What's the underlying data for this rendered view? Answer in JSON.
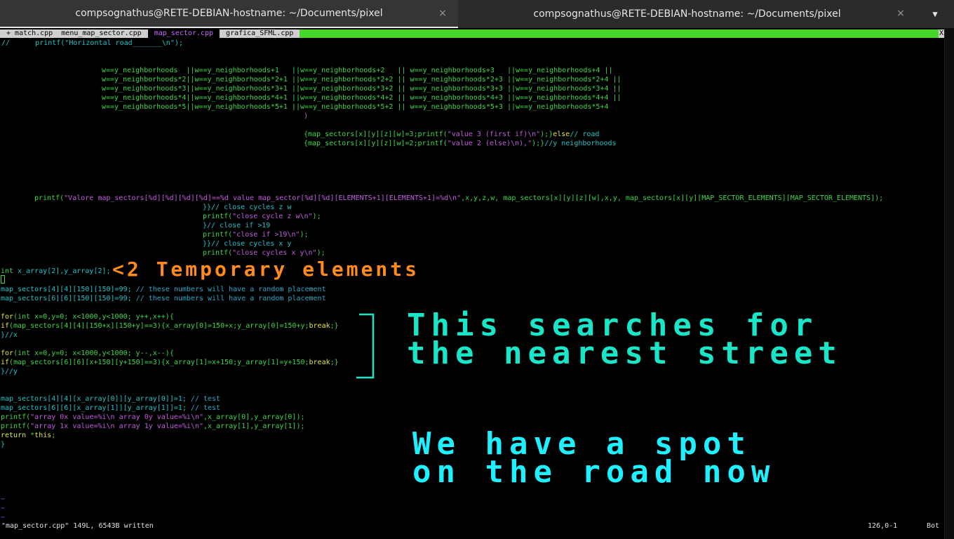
{
  "window": {
    "tabs": [
      {
        "title": "compsognathus@RETE-DEBIAN-hostname: ~/Documents/pixel",
        "active": true
      },
      {
        "title": "compsognathus@RETE-DEBIAN-hostname: ~/Documents/pixel",
        "active": false
      }
    ],
    "close_glyph": "×",
    "menu_glyph": "▼"
  },
  "vim": {
    "tabline": {
      "tabs": [
        {
          "label": " + match.cpp  menu_map_sector.cpp ",
          "selected": false
        },
        {
          "label": " map_sector.cpp ",
          "selected": true
        },
        {
          "label": " grafica_SFML.cpp ",
          "selected": false
        }
      ],
      "close_label": "X"
    },
    "lines": {
      "l1": "//      printf(\"Horizontal road_______\\n\");",
      "c1a": "w==y_neighborhoods  ||w==y_neighborhoods+1   ||",
      "c1b": "w==y_neighborhoods+2   || w==y_neighborhoods+3   ||w==y_neighborhoods+4 ||",
      "c2a": "w==y_neighborhoods*2||w==y_neighborhoods*2+1 ||",
      "c2b": "w==y_neighborhoods*2+2 || w==y_neighborhoods*2+3 ||w==y_neighborhoods*2+4 ||",
      "c3a": "w==y_neighborhoods*3||w==y_neighborhoods*3+1 ||",
      "c3b": "w==y_neighborhoods*3+2 || w==y_neighborhoods*3+3 ||w==y_neighborhoods*3+4 ||",
      "c4a": "w==y_neighborhoods*4||w==y_neighborhoods*4+1 ||",
      "c4b": "w==y_neighborhoods*4+2 || w==y_neighborhoods*4+3 ||w==y_neighborhoods*4+4 ||",
      "c5a": "w==y_neighborhoods*5||w==y_neighborhoods*5+1 ||",
      "c5b": "w==y_neighborhoods*5+2 || w==y_neighborhoods*5+3 ||w==y_neighborhoods*5+4",
      "paren": ")",
      "v3a": "{map_sectors[x][y][z][w]=3;printf(",
      "v3b": "\"value 3 (first if)\\n\"",
      "v3c": ");}",
      "v3d": "else",
      "v3e": "// road",
      "v2a": "{map_sectors[x][y][z][w]=2;printf(",
      "v2b": "\"value 2 (else)\\n),\"",
      "v2c": ");}",
      "v2d": "//y neighborhoods",
      "pv1": "printf(",
      "pv2": "\"Valore map_sectors[%d][%d][%d][%d]==%d value map_sector[%d][%d][ELEMENTS+1][ELEMENTS+1]=%d\\n\"",
      "pv3": ",x,y,z,w, map_sectors[x][y][z][w],x,y, map_sectors[x][y][MAP_SECTOR_ELEMENTS][MAP_SECTOR_ELEMENTS]);",
      "cc1": "}}// close cycles z w",
      "cc2a": "printf(",
      "cc2b": "\"close cycle z w\\n\"",
      "cc2c": ");",
      "cc3": "}// close if >19",
      "cc4a": "printf(",
      "cc4b": "\"close if >19\\n\"",
      "cc4c": ");",
      "cc5": "}}// close cycles x y",
      "cc6a": "printf(",
      "cc6b": "\"close cycles x y\\n\"",
      "cc6c": ");",
      "ia1": "int",
      "ia2": " x_array[2],y_array[2];",
      "ms1a": "map_sectors[4][4][150][150]=99;",
      "ms1b": " // these numbers will have a random placement",
      "ms2a": "map_sectors[6][6][150][150]=99;",
      "ms2b": " // these numbers will have a random placement",
      "f1a": "for",
      "f1b": "(int x=0,y=0; x<1000,y<1000; y++,x++){",
      "if1a": "if",
      "if1b": "(map_sectors[4][4][150+x][150+y]==3){x_array[0]=150+x;y_array[0]=150+y;",
      "if1c": "break",
      "if1d": ";}",
      "cx": "}//x",
      "f2a": "for",
      "f2b": "(int x=0,y=0; x<1000,y<1000; y--,x--){",
      "if2a": "if",
      "if2b": "(map_sectors[6][6][x+150][y+150]==3){x_array[1]=x+150;y_array[1]=y+150;",
      "if2c": "break",
      "if2d": ";}",
      "cyl": "}//y",
      "t1a": "map_sectors[4][4][x_array[0]][y_array[0]]=1;",
      "t1b": " // test",
      "t2a": "map_sectors[6][6][x_array[1]][y_array[1]]=1;",
      "t2b": " // test",
      "p1a": "printf(",
      "p1b": "\"array 0x value=%i\\n array 0y value=%i\\n\"",
      "p1c": ",x_array[0],y_array[0]);",
      "p2a": "printf(",
      "p2b": "\"array 1x value=%i\\n array 1y value=%i\\n\"",
      "p2c": ",x_array[1],y_array[1]);",
      "r1": "return",
      "r2": " *",
      "r3": "this",
      "r4": ";",
      "brace": "}",
      "tilde": "~"
    },
    "status": {
      "message": "\"map_sector.cpp\" 149L, 6543B written",
      "position": "126,0-1",
      "scroll": "Bot"
    }
  },
  "annotations": {
    "temp": "<2 Temporary elements",
    "search_l1": "This searches for",
    "search_l2": "the nearest street",
    "spot_l1": "We have a spot",
    "spot_l2": "on the road now"
  },
  "colors": {
    "accent_green": "#46d72a",
    "annotation_orange": "#ff8c1a",
    "annotation_cyan": "#19e6c8",
    "annotation_blue": "#1ff0ff"
  }
}
